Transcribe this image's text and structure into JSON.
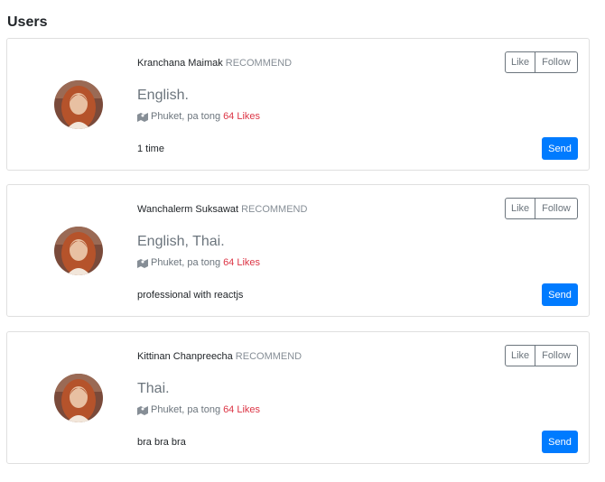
{
  "section": {
    "title": "Users"
  },
  "users": [
    {
      "name": "Kranchana Maimak",
      "badge": "RECOMMEND",
      "languages": "English.",
      "location": "Phuket, pa tong",
      "likes": "64 Likes",
      "description": "1 time",
      "like_label": "Like",
      "follow_label": "Follow",
      "send_label": "Send"
    },
    {
      "name": "Wanchalerm Suksawat",
      "badge": "RECOMMEND",
      "languages": "English, Thai.",
      "location": "Phuket, pa tong",
      "likes": "64 Likes",
      "description": "professional with reactjs",
      "like_label": "Like",
      "follow_label": "Follow",
      "send_label": "Send"
    },
    {
      "name": "Kittinan Chanpreecha",
      "badge": "RECOMMEND",
      "languages": "Thai.",
      "location": "Phuket, pa tong",
      "likes": "64 Likes",
      "description": "bra bra bra",
      "like_label": "Like",
      "follow_label": "Follow",
      "send_label": "Send"
    }
  ],
  "colors": {
    "primary": "#007bff",
    "likes": "#dc3545",
    "muted": "#6c757d",
    "border": "#dfdfdf"
  },
  "icons": {
    "location": "map-icon",
    "avatar": "user-avatar"
  }
}
